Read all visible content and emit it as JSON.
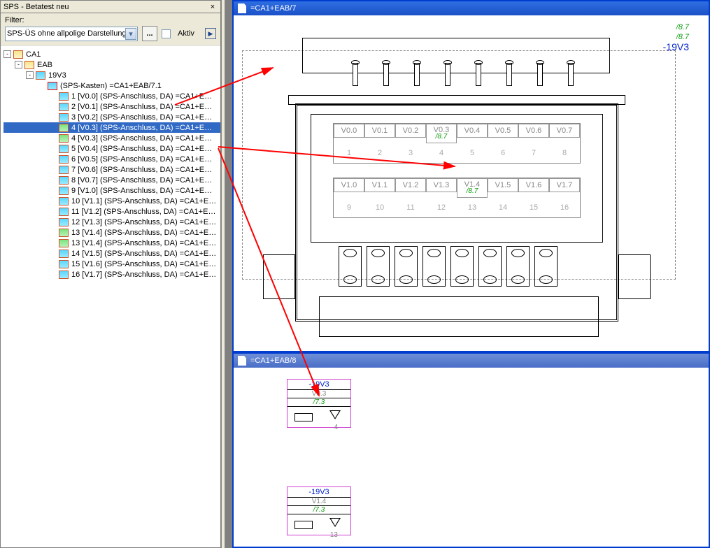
{
  "panel": {
    "title": "SPS - Betatest neu",
    "close": "×",
    "filter_label": "Filter:",
    "filter_value": "SPS-ÜS ohne allpolige Darstellung",
    "more_btn": "...",
    "active_label": "Aktiv"
  },
  "tree": {
    "root": "CA1",
    "lvl2": "EAB",
    "lvl3": "19V3",
    "box": "(SPS-Kasten) =CA1+EAB/7.1",
    "items": [
      "1  [V0.0] (SPS-Anschluss, DA) =CA1+E…",
      "2  [V0.1] (SPS-Anschluss, DA) =CA1+E…",
      "3  [V0.2] (SPS-Anschluss, DA) =CA1+E…",
      "4  [V0.3] (SPS-Anschluss, DA) =CA1+E…",
      "4  [V0.3] (SPS-Anschluss, DA) =CA1+E…",
      "5  [V0.4] (SPS-Anschluss, DA) =CA1+E…",
      "6  [V0.5] (SPS-Anschluss, DA) =CA1+E…",
      "7  [V0.6] (SPS-Anschluss, DA) =CA1+E…",
      "8  [V0.7] (SPS-Anschluss, DA) =CA1+E…",
      "9  [V1.0] (SPS-Anschluss, DA) =CA1+E…",
      "10  [V1.1] (SPS-Anschluss, DA) =CA1+E…",
      "11  [V1.2] (SPS-Anschluss, DA) =CA1+E…",
      "12  [V1.3] (SPS-Anschluss, DA) =CA1+E…",
      "13  [V1.4] (SPS-Anschluss, DA) =CA1+E…",
      "13  [V1.4] (SPS-Anschluss, DA) =CA1+E…",
      "14  [V1.5] (SPS-Anschluss, DA) =CA1+E…",
      "15  [V1.6] (SPS-Anschluss, DA) =CA1+E…",
      "16  [V1.7] (SPS-Anschluss, DA) =CA1+E…"
    ],
    "selected_index": 3
  },
  "doc1": {
    "title": "=CA1+EAB/7",
    "hdr_a": "/8.7",
    "hdr_b": "/8.7",
    "hdr_c": "-19V3",
    "row1": [
      "V0.0",
      "V0.1",
      "V0.2",
      "V0.3",
      "V0.4",
      "V0.5",
      "V0.6",
      "V0.7"
    ],
    "row1_sub3": "/8.7",
    "nums1": [
      "1",
      "2",
      "3",
      "4",
      "5",
      "6",
      "7",
      "8"
    ],
    "row2": [
      "V1.0",
      "V1.1",
      "V1.2",
      "V1.3",
      "V1.4",
      "V1.5",
      "V1.6",
      "V1.7"
    ],
    "row2_sub4": "/8.7",
    "nums2": [
      "9",
      "10",
      "11",
      "12",
      "13",
      "14",
      "15",
      "16"
    ]
  },
  "doc2": {
    "title": "=CA1+EAB/8",
    "sym1": {
      "name": "-19V3",
      "chan": "V0.3",
      "ref": "/7.3",
      "num": "4"
    },
    "sym2": {
      "name": "-19V3",
      "chan": "V1.4",
      "ref": "/7.3",
      "num": "13"
    }
  }
}
